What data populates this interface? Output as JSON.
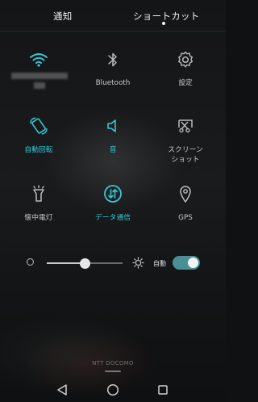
{
  "tabs": [
    {
      "label": "通知",
      "active": false
    },
    {
      "label": "ショートカット",
      "active": true
    }
  ],
  "tiles": [
    {
      "label": "",
      "icon": "wifi-icon",
      "active": true,
      "label_obscured": true
    },
    {
      "label": "Bluetooth",
      "icon": "bluetooth-icon",
      "active": false
    },
    {
      "label": "設定",
      "icon": "gear-icon",
      "active": false
    },
    {
      "label": "自動回転",
      "icon": "auto-rotate-icon",
      "active": true
    },
    {
      "label": "音",
      "icon": "speaker-icon",
      "active": true
    },
    {
      "label": "スクリーン\nショット",
      "icon": "screenshot-icon",
      "active": false
    },
    {
      "label": "懐中電灯",
      "icon": "flashlight-icon",
      "active": false
    },
    {
      "label": "データ通信",
      "icon": "mobile-data-icon",
      "active": true
    },
    {
      "label": "GPS",
      "icon": "location-icon",
      "active": false
    }
  ],
  "brightness": {
    "level": 0.5,
    "auto_label": "自動",
    "auto_enabled": true
  },
  "carrier": "NTT DOCOMO",
  "navbar": [
    "back-icon",
    "home-icon",
    "recents-icon"
  ],
  "colors": {
    "accent": "#37c7d6",
    "inactive": "#c8c8c8",
    "toggle_on": "#4a8f96"
  }
}
